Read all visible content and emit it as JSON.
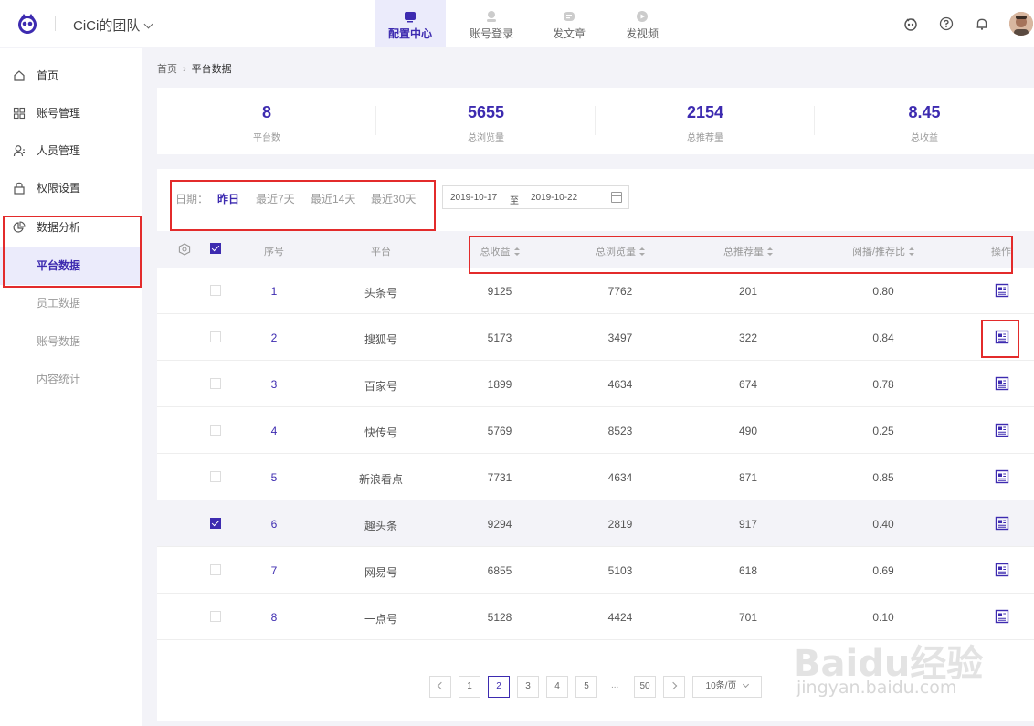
{
  "header": {
    "team_name": "CiCi的团队",
    "tabs": [
      {
        "label": "配置中心",
        "icon": "tv-icon",
        "active": true
      },
      {
        "label": "账号登录",
        "icon": "account-login-icon",
        "active": false
      },
      {
        "label": "发文章",
        "icon": "article-icon",
        "active": false
      },
      {
        "label": "发视频",
        "icon": "video-icon",
        "active": false
      }
    ],
    "right_icons": [
      "robot-icon",
      "help-icon",
      "bell-icon",
      "avatar"
    ]
  },
  "sidebar": {
    "items": [
      {
        "label": "首页",
        "icon": "home-icon"
      },
      {
        "label": "账号管理",
        "icon": "grid-icon"
      },
      {
        "label": "人员管理",
        "icon": "user-icon"
      },
      {
        "label": "权限设置",
        "icon": "lock-icon"
      },
      {
        "label": "数据分析",
        "icon": "pie-chart-icon"
      }
    ],
    "sub_items": [
      {
        "label": "平台数据",
        "active": true
      },
      {
        "label": "员工数据",
        "active": false
      },
      {
        "label": "账号数据",
        "active": false
      },
      {
        "label": "内容统计",
        "active": false
      }
    ]
  },
  "breadcrumb": {
    "home": "首页",
    "current": "平台数据"
  },
  "stats": [
    {
      "value": "8",
      "label": "平台数"
    },
    {
      "value": "5655",
      "label": "总浏览量"
    },
    {
      "value": "2154",
      "label": "总推荐量"
    },
    {
      "value": "8.45",
      "label": "总收益"
    }
  ],
  "filter": {
    "date_label": "日期：",
    "options": [
      "昨日",
      "最近7天",
      "最近14天",
      "最近30天"
    ],
    "active_option": "昨日",
    "start_date": "2019-10-17",
    "to": "至",
    "end_date": "2019-10-22"
  },
  "table": {
    "columns": [
      "序号",
      "平台",
      "总收益",
      "总浏览量",
      "总推荐量",
      "阅播/推荐比",
      "操作"
    ],
    "rows": [
      {
        "seq": "1",
        "platform": "头条号",
        "income": "9125",
        "views": "7762",
        "recs": "201",
        "ratio": "0.80",
        "checked": false
      },
      {
        "seq": "2",
        "platform": "搜狐号",
        "income": "5173",
        "views": "3497",
        "recs": "322",
        "ratio": "0.84",
        "checked": false
      },
      {
        "seq": "3",
        "platform": "百家号",
        "income": "1899",
        "views": "4634",
        "recs": "674",
        "ratio": "0.78",
        "checked": false
      },
      {
        "seq": "4",
        "platform": "快传号",
        "income": "5769",
        "views": "8523",
        "recs": "490",
        "ratio": "0.25",
        "checked": false
      },
      {
        "seq": "5",
        "platform": "新浪看点",
        "income": "7731",
        "views": "4634",
        "recs": "871",
        "ratio": "0.85",
        "checked": false
      },
      {
        "seq": "6",
        "platform": "趣头条",
        "income": "9294",
        "views": "2819",
        "recs": "917",
        "ratio": "0.40",
        "checked": true
      },
      {
        "seq": "7",
        "platform": "网易号",
        "income": "6855",
        "views": "5103",
        "recs": "618",
        "ratio": "0.69",
        "checked": false
      },
      {
        "seq": "8",
        "platform": "一点号",
        "income": "5128",
        "views": "4424",
        "recs": "701",
        "ratio": "0.10",
        "checked": false
      }
    ]
  },
  "pagination": {
    "pages": [
      "1",
      "2",
      "3",
      "4",
      "5",
      "...",
      "50"
    ],
    "current": "2",
    "page_size": "10条/页"
  },
  "watermark": {
    "brand": "Baidu经验",
    "url": "jingyan.baidu.com"
  },
  "colors": {
    "accent": "#3d2bb0",
    "annotation": "#e32b2b"
  }
}
